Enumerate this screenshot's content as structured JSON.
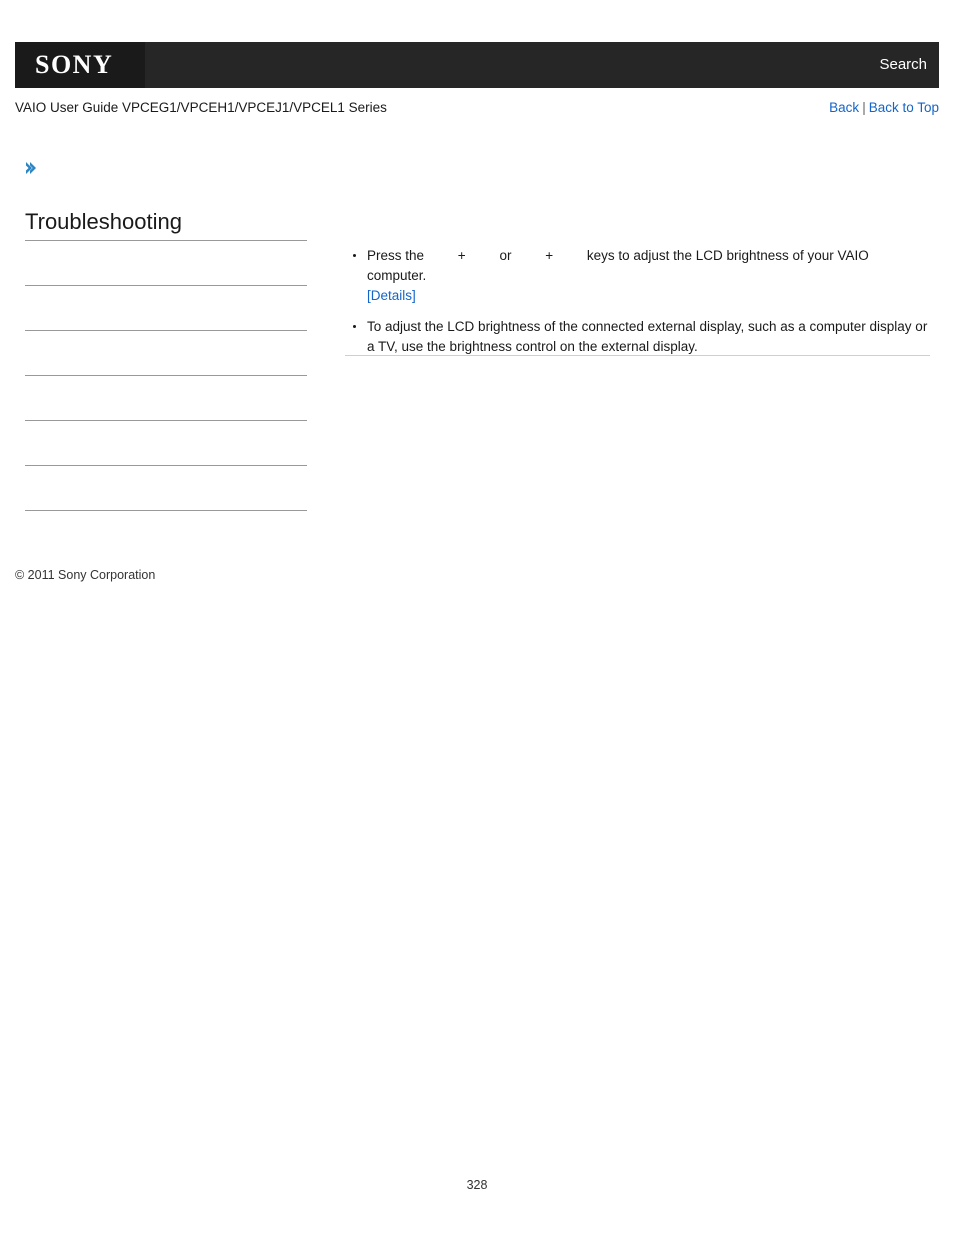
{
  "header": {
    "logo_text": "SONY",
    "search_label": "Search"
  },
  "subheader": {
    "guide_title": "VAIO User Guide VPCEG1/VPCEH1/VPCEJ1/VPCEL1 Series",
    "back_label": "Back",
    "separator": "|",
    "back_to_top_label": "Back to Top"
  },
  "sidebar": {
    "chevron_icon": "chevron-double-right-icon",
    "accent_color": "#2a85c4",
    "section_title": "Troubleshooting",
    "items": [
      {
        "label": ""
      },
      {
        "label": ""
      },
      {
        "label": ""
      },
      {
        "label": ""
      },
      {
        "label": ""
      },
      {
        "label": ""
      },
      {
        "label": ""
      }
    ],
    "copyright": "© 2011 Sony Corporation"
  },
  "main": {
    "bullets": [
      {
        "text_before_key1": "Press the",
        "key1_alt": "fn-key-image",
        "plus1": "+",
        "key2_alt": "f5-key-image",
        "conjunction": "or",
        "key3_alt": "fn-key-image",
        "plus2": "+",
        "key4_alt": "f6-key-image",
        "text_after": "keys to adjust the LCD brightness of your VAIO computer.",
        "details_link": "[Details]"
      },
      {
        "text": "To adjust the LCD brightness of the connected external display, such as a computer display or a TV, use the brightness control on the external display."
      }
    ]
  },
  "footer": {
    "page_number": "328"
  },
  "colors": {
    "header_bg": "#262626",
    "logo_bg": "#1a1a1a",
    "link_blue": "#1565c9",
    "rule_gray": "#999999"
  }
}
